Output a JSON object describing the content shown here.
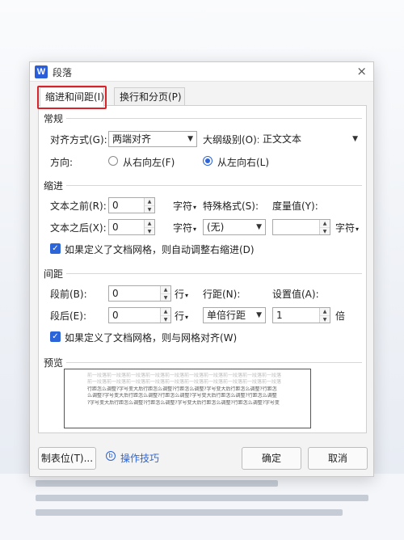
{
  "dialog": {
    "app_icon_letter": "W",
    "title": "段落",
    "close_glyph": "×"
  },
  "tabs": [
    {
      "label": "缩进和间距(I)",
      "active": true
    },
    {
      "label": "换行和分页(P)",
      "active": false
    }
  ],
  "general": {
    "section_title": "常规",
    "alignment_label": "对齐方式(G):",
    "alignment_value": "两端对齐",
    "outline_label": "大纲级别(O):",
    "outline_value": "正文文本",
    "direction_label": "方向:",
    "rtl_label": "从右向左(F)",
    "ltr_label": "从左向右(L)",
    "direction_selected": "ltr"
  },
  "indent": {
    "section_title": "缩进",
    "before_label": "文本之前(R):",
    "before_value": "0",
    "before_unit": "字符",
    "after_label": "文本之后(X):",
    "after_value": "0",
    "after_unit": "字符",
    "special_label": "特殊格式(S):",
    "special_value": "(无)",
    "measure_label": "度量值(Y):",
    "measure_value": "",
    "measure_unit": "字符",
    "grid_checkbox_label": "如果定义了文档网格，则自动调整右缩进(D)",
    "grid_checked": true
  },
  "spacing": {
    "section_title": "间距",
    "before_label": "段前(B):",
    "before_value": "0",
    "before_unit": "行",
    "after_label": "段后(E):",
    "after_value": "0",
    "after_unit": "行",
    "line_label": "行距(N):",
    "line_value": "单倍行距",
    "setting_label": "设置值(A):",
    "setting_value": "1",
    "setting_unit": "倍",
    "grid_checkbox_label": "如果定义了文档网格，则与网格对齐(W)",
    "grid_checked": true
  },
  "preview": {
    "section_title": "预览",
    "lines": [
      "前一段落前一段落前一段落前一段落前一段落前一段落前一段落前一段落前一段落前一段落",
      "前一段落前一段落前一段落前一段落前一段落前一段落前一段落前一段落前一段落前一段落",
      "行距怎么调整?字号变大后行距怎么调整?行距怎么调整?字号变大后行距怎么调整?行距怎",
      "么调整?字号变大后行距怎么调整?行距怎么调整?字号变大后行距怎么调整?行距怎么调整",
      "?字号变大后行距怎么调整?行距怎么调整?字号变大后行距怎么调整?行距怎么调整?字号变"
    ]
  },
  "footer": {
    "tabs_button": "制表位(T)...",
    "tips_icon": "b",
    "tips_link": "操作技巧",
    "ok_button": "确定",
    "cancel_button": "取消"
  },
  "colors": {
    "accent": "#2b65d9",
    "highlight": "#d8232a"
  }
}
